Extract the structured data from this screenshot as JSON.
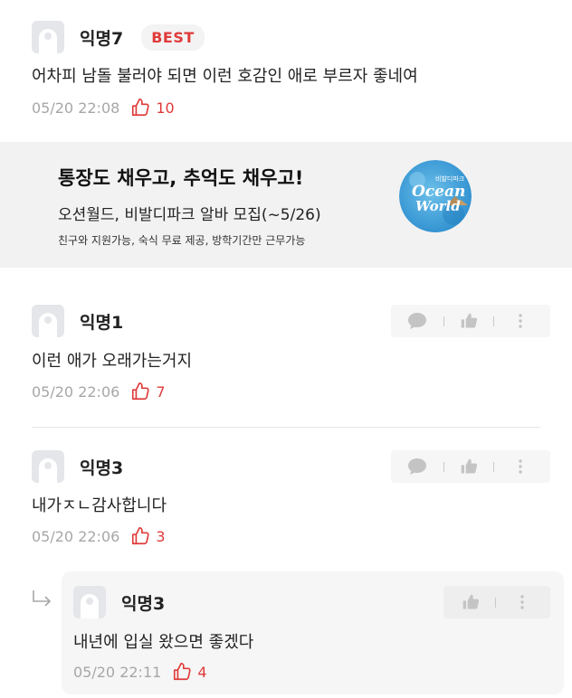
{
  "comments": [
    {
      "nick": "익명7",
      "badge": "BEST",
      "text": "어차피 남돌 불러야 되면 이런 호감인 애로 부르자 좋네여",
      "date": "05/20 22:08",
      "likes": "10"
    },
    {
      "nick": "익명1",
      "text": "이런 애가 오래가는거지",
      "date": "05/20 22:06",
      "likes": "7"
    },
    {
      "nick": "익명3",
      "text": "내가ㅈㄴ감사합니다",
      "date": "05/20 22:06",
      "likes": "3"
    }
  ],
  "reply": {
    "nick": "익명3",
    "text": "내년에 입실 왔으면 좋겠다",
    "date": "05/20 22:11",
    "likes": "4"
  },
  "ad": {
    "title": "통장도 채우고, 추억도 채우고!",
    "subtitle": "오션월드, 비발디파크 알바 모집(~5/26)",
    "details": "친구와 지원가능, 숙식 무료 제공, 방학기간만 근무가능",
    "logo_small": "비발디파크",
    "logo_line1": "Ocean",
    "logo_line2": "World"
  },
  "icons": {
    "like": "thumbs-up-outline-icon",
    "comment": "speech-bubble-icon",
    "vote": "thumbs-up-icon",
    "more": "more-vertical-icon",
    "reply": "reply-arrow-icon",
    "avatar": "default-avatar-icon"
  },
  "colors": {
    "accent": "#e03a3a",
    "muted": "#a7a7a7",
    "icon_gray": "#c4c4c4"
  }
}
